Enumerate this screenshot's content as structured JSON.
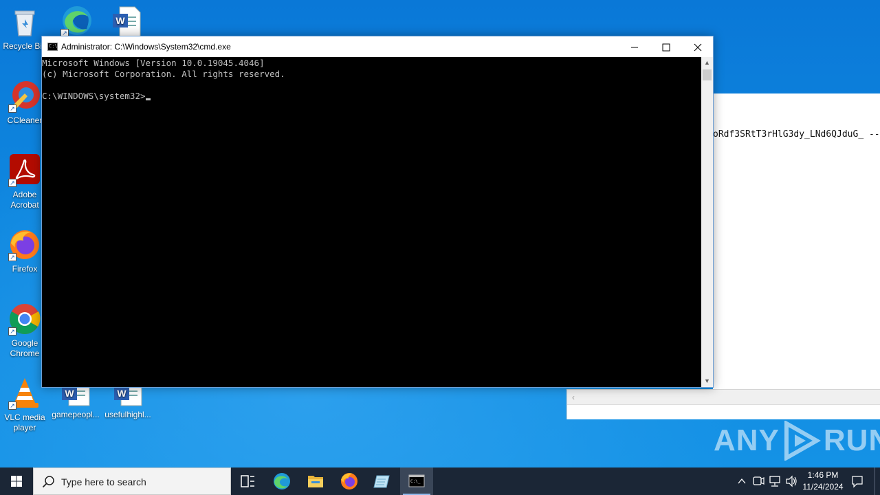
{
  "desktop": {
    "icons": [
      {
        "label": "Recycle Bin",
        "icon": "recycle-bin-icon"
      },
      {
        "label": "",
        "icon": "edge-icon"
      },
      {
        "label": "",
        "icon": "word-document-icon"
      },
      {
        "label": "CCleaner",
        "icon": "ccleaner-icon"
      },
      {
        "label": "Adobe Acrobat",
        "icon": "acrobat-icon"
      },
      {
        "label": "Firefox",
        "icon": "firefox-icon"
      },
      {
        "label": "Google Chrome",
        "icon": "chrome-icon"
      },
      {
        "label": "VLC media player",
        "icon": "vlc-icon"
      },
      {
        "label": "gamepeopl...",
        "icon": "word-document-icon"
      },
      {
        "label": "usefulhighl...",
        "icon": "word-document-icon"
      }
    ]
  },
  "background_window": {
    "text": "oRdf3SRtT3rHlG3dy_LNd6QJduG_ --"
  },
  "cmd_window": {
    "title": "Administrator: C:\\Windows\\System32\\cmd.exe",
    "buttons": {
      "minimize": "—",
      "maximize": "☐",
      "close": "✕"
    },
    "lines": [
      "Microsoft Windows [Version 10.0.19045.4046]",
      "(c) Microsoft Corporation. All rights reserved.",
      "",
      "C:\\WINDOWS\\system32>"
    ]
  },
  "watermark": {
    "left": "ANY",
    "right": "RUN"
  },
  "taskbar": {
    "search_placeholder": "Type here to search",
    "apps": [
      "task-view-icon",
      "edge-icon",
      "file-explorer-icon",
      "firefox-icon",
      "notepad-icon",
      "cmd-icon"
    ],
    "active_app": "cmd-icon",
    "tray": [
      "chevron-up-icon",
      "meet-now-icon",
      "network-icon",
      "volume-icon"
    ],
    "time": "1:46 PM",
    "date": "11/24/2024",
    "notification_icon": "notification-icon"
  },
  "colors": {
    "desktop_blue": "#0f88e0",
    "taskbar": "#1b2636",
    "console_bg": "#000000",
    "console_text": "#c0c0c0"
  }
}
